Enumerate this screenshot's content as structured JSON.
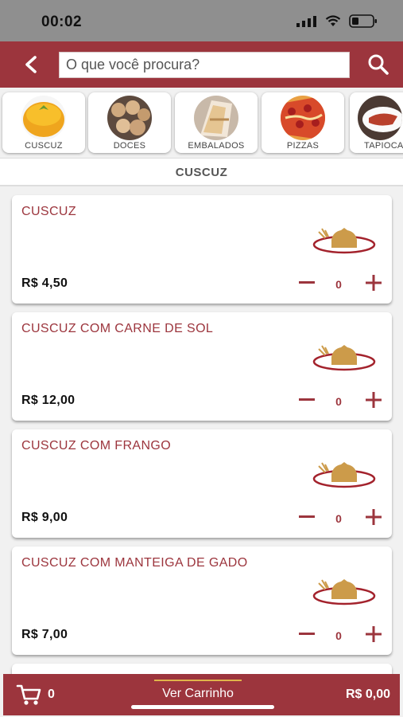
{
  "status": {
    "time": "00:02"
  },
  "search": {
    "placeholder": "O que você procura?"
  },
  "categories": [
    {
      "label": "CUSCUZ"
    },
    {
      "label": "DOCES"
    },
    {
      "label": "EMBALADOS"
    },
    {
      "label": "PIZZAS"
    },
    {
      "label": "TAPIOCA"
    }
  ],
  "section": {
    "title": "CUSCUZ"
  },
  "products": [
    {
      "name": "CUSCUZ",
      "price": "R$  4,50",
      "qty": "0"
    },
    {
      "name": "CUSCUZ COM CARNE DE SOL",
      "price": "R$  12,00",
      "qty": "0"
    },
    {
      "name": "CUSCUZ COM FRANGO",
      "price": "R$  9,00",
      "qty": "0"
    },
    {
      "name": "CUSCUZ COM MANTEIGA DE GADO",
      "price": "R$  7,00",
      "qty": "0"
    }
  ],
  "cart": {
    "count": "0",
    "label": "Ver Carrinho",
    "total": "R$ 0,00"
  },
  "colors": {
    "brand": "#9c353d",
    "accent": "#e0b34a"
  },
  "icons": [
    "back-arrow-icon",
    "search-icon",
    "minus-icon",
    "plus-icon",
    "cart-icon",
    "signal-icon",
    "wifi-icon",
    "battery-icon"
  ]
}
